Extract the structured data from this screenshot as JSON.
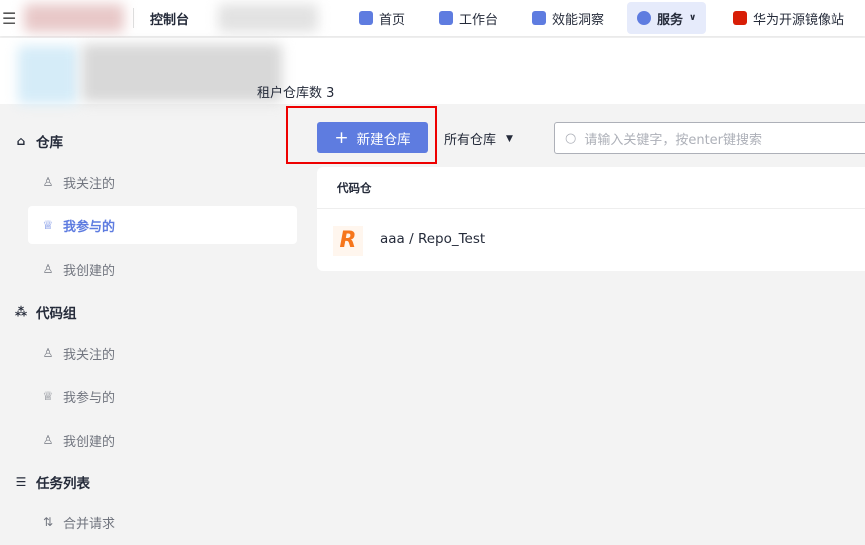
{
  "topbar": {
    "console": "控制台",
    "nav": [
      {
        "label": "首页",
        "icon": "home-icon"
      },
      {
        "label": "工作台",
        "icon": "workbench-icon"
      },
      {
        "label": "效能洞察",
        "icon": "insight-icon"
      },
      {
        "label": "服务",
        "icon": "service-icon"
      },
      {
        "label": "华为开源镜像站",
        "icon": "mirror-icon"
      }
    ]
  },
  "header": {
    "repo_count_label": "租户仓库数",
    "repo_count": "3"
  },
  "sidebar": {
    "repo": {
      "title": "仓库",
      "items": [
        "我关注的",
        "我参与的",
        "我创建的"
      ]
    },
    "group": {
      "title": "代码组",
      "items": [
        "我关注的",
        "我参与的",
        "我创建的"
      ]
    },
    "tasks": {
      "title": "任务列表",
      "items": [
        "合并请求"
      ]
    }
  },
  "toolbar": {
    "new_repo": "新建仓库",
    "filter": "所有仓库",
    "search_placeholder": "请输入关键字，按enter键搜索"
  },
  "list": {
    "header": "代码仓",
    "rows": [
      {
        "name": "aaa / Repo_Test"
      }
    ]
  },
  "colors": {
    "accent": "#5e7ce0",
    "highlight": "#e00000"
  }
}
